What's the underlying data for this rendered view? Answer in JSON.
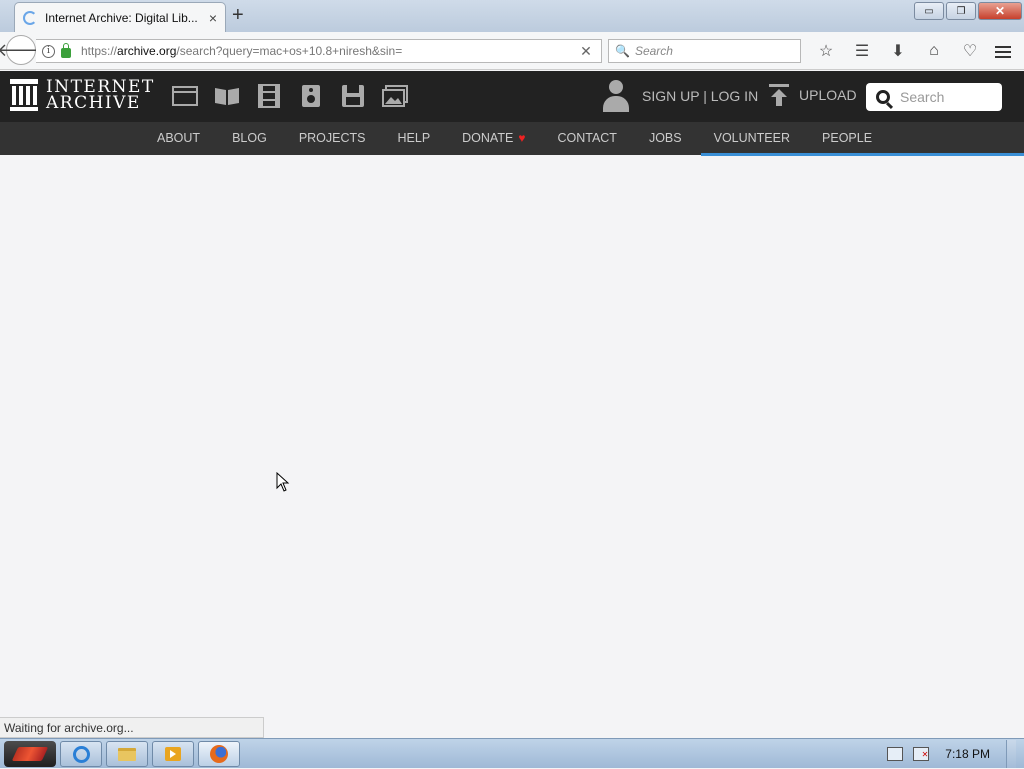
{
  "browser": {
    "tab_title": "Internet Archive: Digital Lib...",
    "tab_close": "×",
    "new_tab": "+",
    "url_prefix": "https://",
    "url_domain": "archive.org",
    "url_path": "/search?query=mac+os+10.8+niresh&sin=",
    "search_placeholder": "Search",
    "status_text": "Waiting for archive.org...",
    "window_buttons": {
      "minimize": "▭",
      "restore": "❐",
      "close": "✕"
    }
  },
  "ia": {
    "logo_line1": "INTERNET",
    "logo_line2": "ARCHIVE",
    "media_icons": [
      "web-icon",
      "texts-icon",
      "video-icon",
      "audio-icon",
      "software-icon",
      "images-icon"
    ],
    "auth_label": "SIGN UP | LOG IN",
    "upload_label": "UPLOAD",
    "search_placeholder": "Search",
    "nav": [
      {
        "label": "ABOUT"
      },
      {
        "label": "BLOG"
      },
      {
        "label": "PROJECTS"
      },
      {
        "label": "HELP"
      },
      {
        "label": "DONATE"
      },
      {
        "label": "CONTACT"
      },
      {
        "label": "JOBS"
      },
      {
        "label": "VOLUNTEER"
      },
      {
        "label": "PEOPLE"
      }
    ]
  },
  "taskbar": {
    "clock": "7:18 PM"
  },
  "colors": {
    "ia_header": "#222222",
    "ia_nav": "#333333",
    "progress": "#3a8fd6",
    "donate_heart": "#e22222"
  }
}
